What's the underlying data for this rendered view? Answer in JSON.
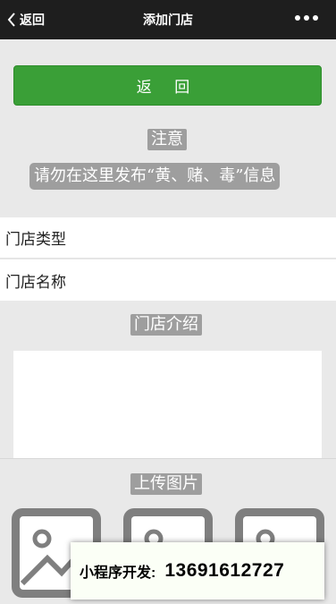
{
  "navbar": {
    "back_label": "返回",
    "title": "添加门店"
  },
  "back_button": {
    "label": "返 回"
  },
  "notice": {
    "title": "注意",
    "text": "请勿在这里发布“黄、赌、毒”信息"
  },
  "form": {
    "store_type_placeholder": "门店类型",
    "store_name_placeholder": "门店名称",
    "intro_title": "门店介绍",
    "upload_title": "上传图片"
  },
  "promo": {
    "label": "小程序开发:",
    "phone": "13691612727"
  },
  "colors": {
    "navbar": "#1e1e1e",
    "primary_button": "#3a9f37",
    "tag_bg": "#9e9e9e",
    "page_bg": "#e9e9e9"
  }
}
